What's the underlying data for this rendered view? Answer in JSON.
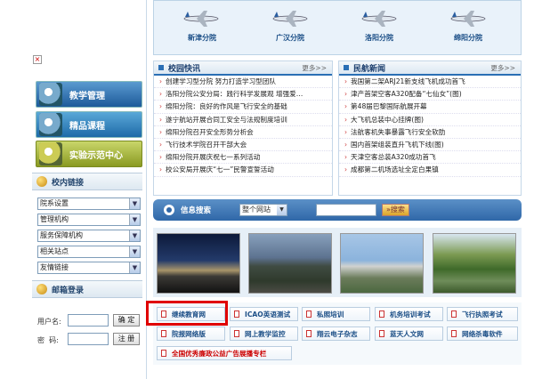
{
  "branches": [
    "新津分院",
    "广汉分院",
    "洛阳分院",
    "绵阳分院"
  ],
  "nav": [
    "教学管理",
    "精品课程",
    "实验示范中心"
  ],
  "campus_links": {
    "title": "校内链接",
    "options": [
      "院系设置",
      "管理机构",
      "服务保障机构",
      "相关站点",
      "友情链接"
    ]
  },
  "mail": {
    "title": "邮箱登录",
    "user_label": "用户名:",
    "pwd_label": "密  码:",
    "confirm": "确 定",
    "register": "注 册"
  },
  "campus_news": {
    "title": "校园快讯",
    "more": "更多>>",
    "items": [
      "创建学习型分院 努力打造学习型团队",
      "洛阳分院公安分局：践行科学发展观 增强爱…",
      "绵阳分院：良好的作风是飞行安全的基础",
      "遂宁航站开展合同工安全与法规制度培训",
      "绵阳分院召开安全形势分析会",
      "飞行技术学院召开干部大会",
      "绵阳分院开展庆祝七一系列活动",
      "校公安局开展庆“七一”民警宣誓活动"
    ]
  },
  "civil_news": {
    "title": "民航新闻",
    "more": "更多>>",
    "items": [
      "我国第二架ARJ21新支线飞机成功首飞",
      "津产首架空客A320配备“七仙女”(图)",
      "第48届巴黎国际航展开幕",
      "大飞机总装中心挂牌(图)",
      "法航客机失事暴露飞行安全软肋",
      "国内首架组装直升飞机下线(图)",
      "天津空客总装A320成功首飞",
      "成都第二机场选址全定白果镇"
    ]
  },
  "search": {
    "title": "信息搜索",
    "scope": "整个网站",
    "input": "",
    "button": "搜索"
  },
  "links_row1": [
    "继续教育网",
    "ICAO英语测试",
    "私照培训",
    "机务培训考试",
    "飞行执照考试"
  ],
  "links_row2": [
    "院报网络版",
    "网上教学监控",
    "翔云电子杂志",
    "蓝天人文网",
    "网络杀毒软件"
  ],
  "links_row3": [
    "全国优秀廉政公益广告展播专栏"
  ],
  "colors": {
    "brand": "#1c4f87",
    "accent": "#2a6fb5",
    "highlight": "#e00000"
  }
}
